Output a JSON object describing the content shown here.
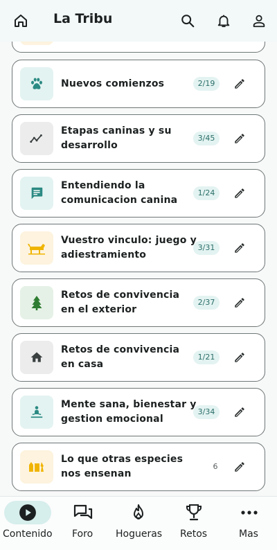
{
  "header": {
    "title": "La Tribu",
    "icons": [
      "home-icon",
      "search-icon",
      "bell-icon",
      "profile-icon"
    ]
  },
  "topics": [
    {
      "title": "Nuevos comienzos",
      "progress": "2/19",
      "icon": "paw-icon",
      "thumb_bg": "#e3f3f1",
      "icon_color": "#2b8a83"
    },
    {
      "title": "Etapas caninas y su desarrollo",
      "progress": "3/45",
      "icon": "trend-icon",
      "thumb_bg": "#ececec",
      "icon_color": "#3a3f3f"
    },
    {
      "title": "Entendiendo la comunicacion canina",
      "progress": "1/24",
      "icon": "chat-icon",
      "thumb_bg": "#e3f3f1",
      "icon_color": "#2b8a83"
    },
    {
      "title": "Vuestro vinculo: juego y adiestramiento",
      "progress": "3/31",
      "icon": "dog-play-icon",
      "thumb_bg": "#fdf3de",
      "icon_color": "#f0b400"
    },
    {
      "title": "Retos de convivencia en el exterior",
      "progress": "2/37",
      "icon": "tree-icon",
      "thumb_bg": "#e5f1e6",
      "icon_color": "#2e7d32"
    },
    {
      "title": "Retos de convivencia en casa",
      "progress": "1/21",
      "icon": "house-icon",
      "thumb_bg": "#ececec",
      "icon_color": "#3a3f3f"
    },
    {
      "title": "Mente sana, bienestar y gestion emocional",
      "progress": "3/34",
      "icon": "meditation-icon",
      "thumb_bg": "#e3f3f1",
      "icon_color": "#2b8a83"
    },
    {
      "title": "Lo que otras especies nos ensenan",
      "progress": "6",
      "icon": "species-icon",
      "thumb_bg": "#fdf3de",
      "icon_color": "#f0b400"
    }
  ],
  "nav": {
    "items": [
      {
        "label": "Contenido",
        "icon": "play-circle-icon",
        "active": true
      },
      {
        "label": "Foro",
        "icon": "forum-icon",
        "active": false
      },
      {
        "label": "Hogueras",
        "icon": "fire-icon",
        "active": false
      },
      {
        "label": "Retos",
        "icon": "trophy-icon",
        "active": false
      },
      {
        "label": "Mas",
        "icon": "more-icon",
        "active": false
      }
    ]
  }
}
